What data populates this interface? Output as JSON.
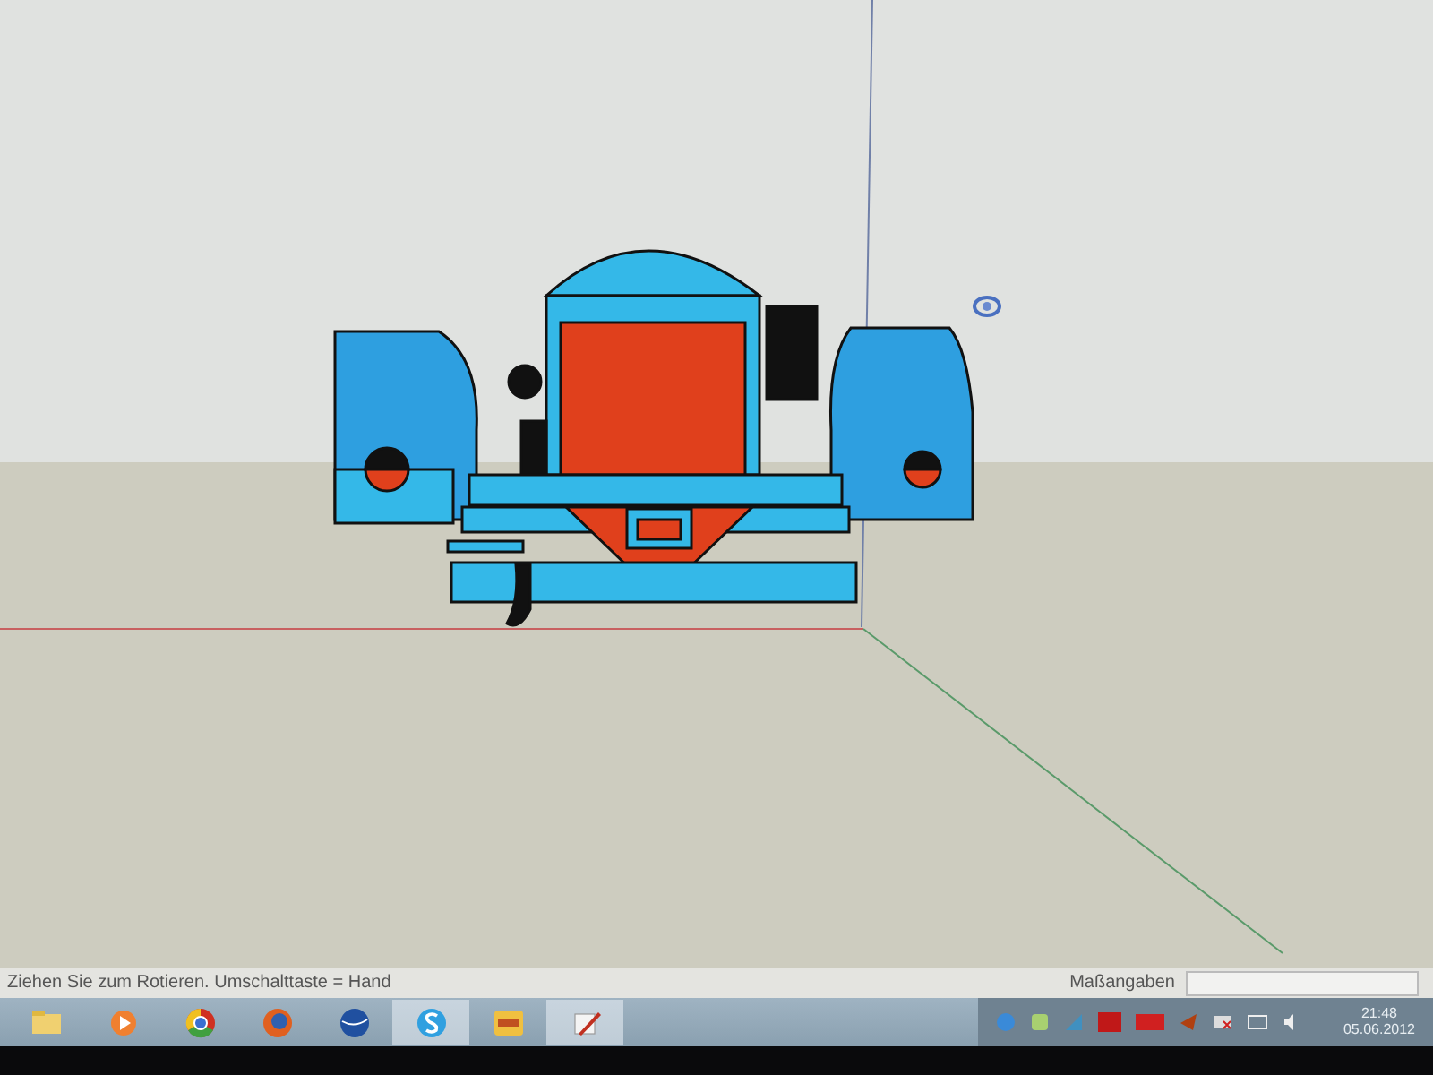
{
  "status_bar": {
    "hint": "Ziehen Sie zum Rotieren.  Umschalttaste = Hand",
    "measurements_label": "Maßangaben"
  },
  "taskbar": {
    "apps": [
      {
        "kind": "folder",
        "selected": false
      },
      {
        "kind": "player",
        "selected": false
      },
      {
        "kind": "chrome",
        "selected": false
      },
      {
        "kind": "firefox",
        "selected": false
      },
      {
        "kind": "earth",
        "selected": false
      },
      {
        "kind": "skype",
        "selected": true
      },
      {
        "kind": "slides",
        "selected": false
      },
      {
        "kind": "sketch",
        "selected": true
      }
    ]
  },
  "clock": {
    "time": "21:48",
    "date": "05.06.2012"
  }
}
